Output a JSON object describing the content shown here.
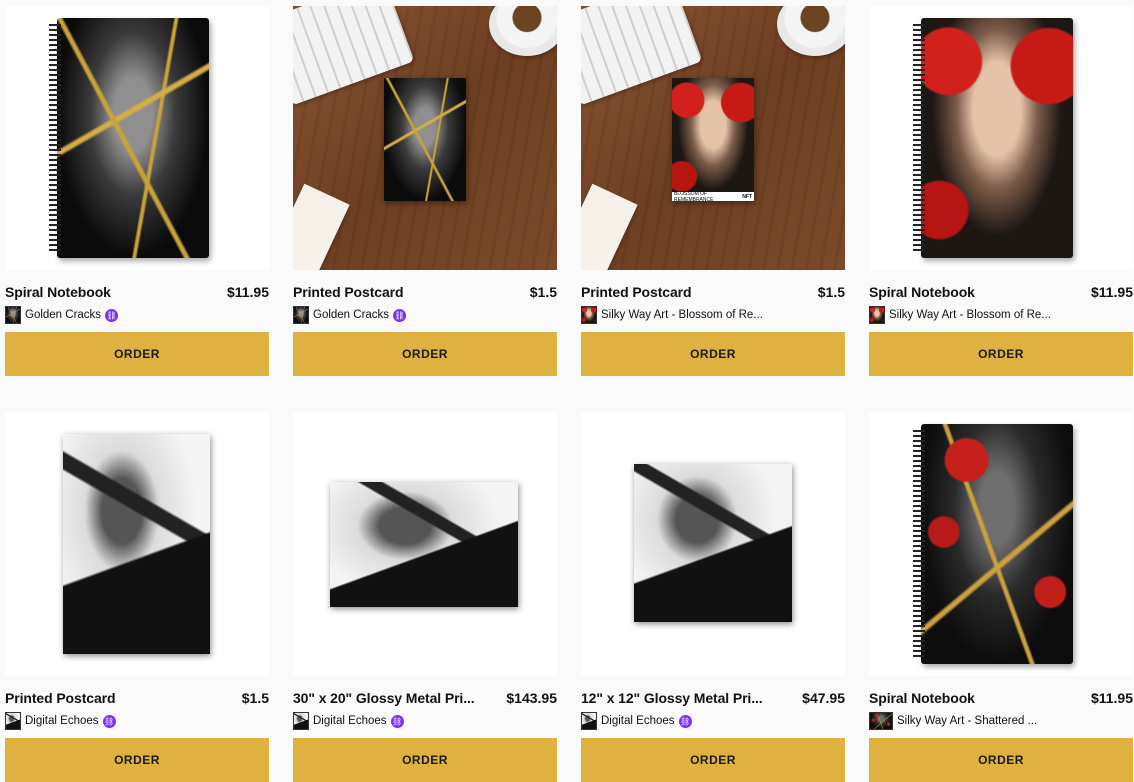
{
  "products": [
    {
      "title": "Spiral Notebook",
      "price": "$11.95",
      "creator": "Golden Cracks",
      "verified": true,
      "order_label": "ORDER"
    },
    {
      "title": "Printed Postcard",
      "price": "$1.5",
      "creator": "Golden Cracks",
      "verified": true,
      "order_label": "ORDER"
    },
    {
      "title": "Printed Postcard",
      "price": "$1.5",
      "creator": "Silky Way Art - Blossom of Re...",
      "verified": false,
      "order_label": "ORDER",
      "overlay_text": "BLOSSOM OF REMEMBRANCE",
      "overlay_badge": "NFT"
    },
    {
      "title": "Spiral Notebook",
      "price": "$11.95",
      "creator": "Silky Way Art - Blossom of Re...",
      "verified": false,
      "order_label": "ORDER"
    },
    {
      "title": "Printed Postcard",
      "price": "$1.5",
      "creator": "Digital Echoes",
      "verified": true,
      "order_label": "ORDER"
    },
    {
      "title": "30\" x 20\" Glossy Metal Pri...",
      "price": "$143.95",
      "creator": "Digital Echoes",
      "verified": true,
      "order_label": "ORDER"
    },
    {
      "title": "12\" x 12\" Glossy Metal Pri...",
      "price": "$47.95",
      "creator": "Digital Echoes",
      "verified": true,
      "order_label": "ORDER"
    },
    {
      "title": "Spiral Notebook",
      "price": "$11.95",
      "creator": "Silky Way Art - Shattered ...",
      "verified": false,
      "order_label": "ORDER"
    }
  ],
  "colors": {
    "order_button": "#dfb141",
    "verified_badge": "#7b2ff7",
    "page_background": "#fafafa"
  },
  "icons": {
    "verified": "link-badge-icon"
  }
}
